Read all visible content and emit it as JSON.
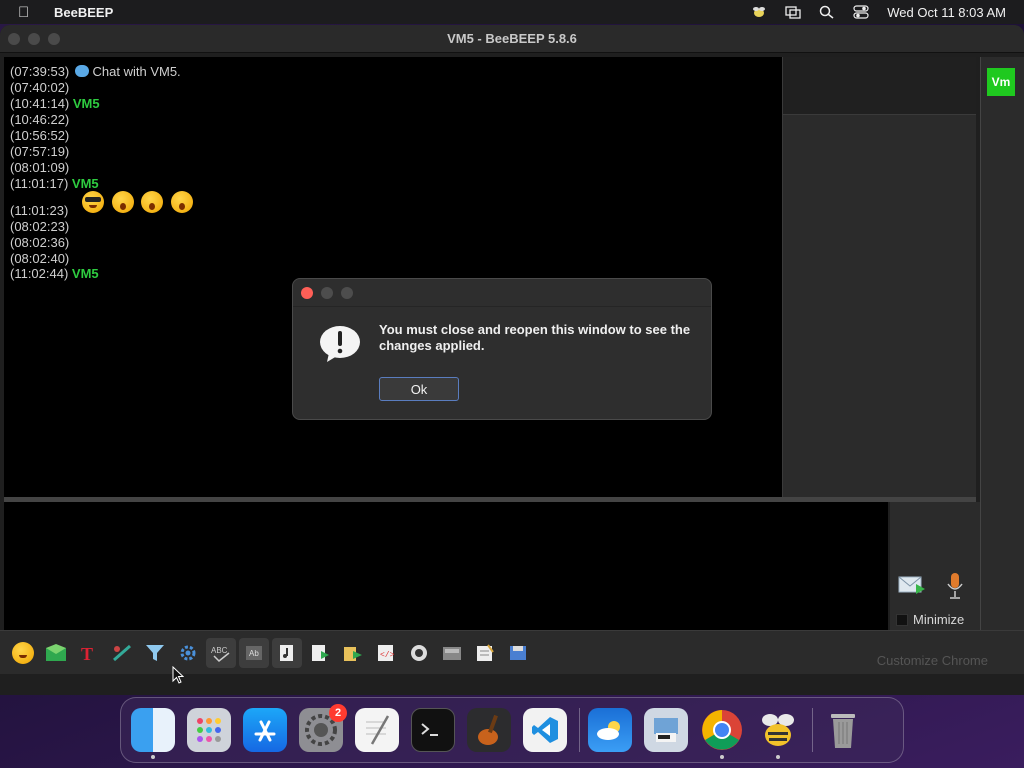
{
  "menubar": {
    "app_name": "BeeBEEP",
    "datetime": "Wed Oct 11  8:03 AM"
  },
  "window": {
    "title": "VM5 - BeeBEEP 5.8.6"
  },
  "chat": {
    "lines": [
      {
        "time": "(07:39:53)",
        "text": "Chat with VM5."
      },
      {
        "time": "(07:40:02)",
        "text": ""
      },
      {
        "time": "(10:41:14)",
        "user": "VM5"
      },
      {
        "time": "(10:46:22)",
        "text": ""
      },
      {
        "time": "(10:56:52)",
        "text": ""
      },
      {
        "time": "(07:57:19)",
        "text": ""
      },
      {
        "time": "(08:01:09)",
        "text": ""
      },
      {
        "time": "(11:01:17)",
        "user": "VM5"
      },
      {
        "time": "(11:01:23)",
        "text": ""
      },
      {
        "time": "(08:02:23)",
        "text": ""
      },
      {
        "time": "(08:02:36)",
        "text": ""
      },
      {
        "time": "(08:02:40)",
        "text": ""
      },
      {
        "time": "(11:02:44)",
        "user": "VM5"
      }
    ]
  },
  "user_avatar": "Vm",
  "side": {
    "minimize_label": "Minimize"
  },
  "background_hint": "Customize Chrome",
  "dialog": {
    "message": "You must close and reopen this window to see the changes applied.",
    "ok_label": "Ok"
  },
  "dock": {
    "settings_badge": "2"
  },
  "colors": {
    "user_name": "#2ecc40",
    "avatar_bg": "#1fc91f",
    "close_red": "#ff5f57",
    "ok_border": "#5a7dbf"
  }
}
